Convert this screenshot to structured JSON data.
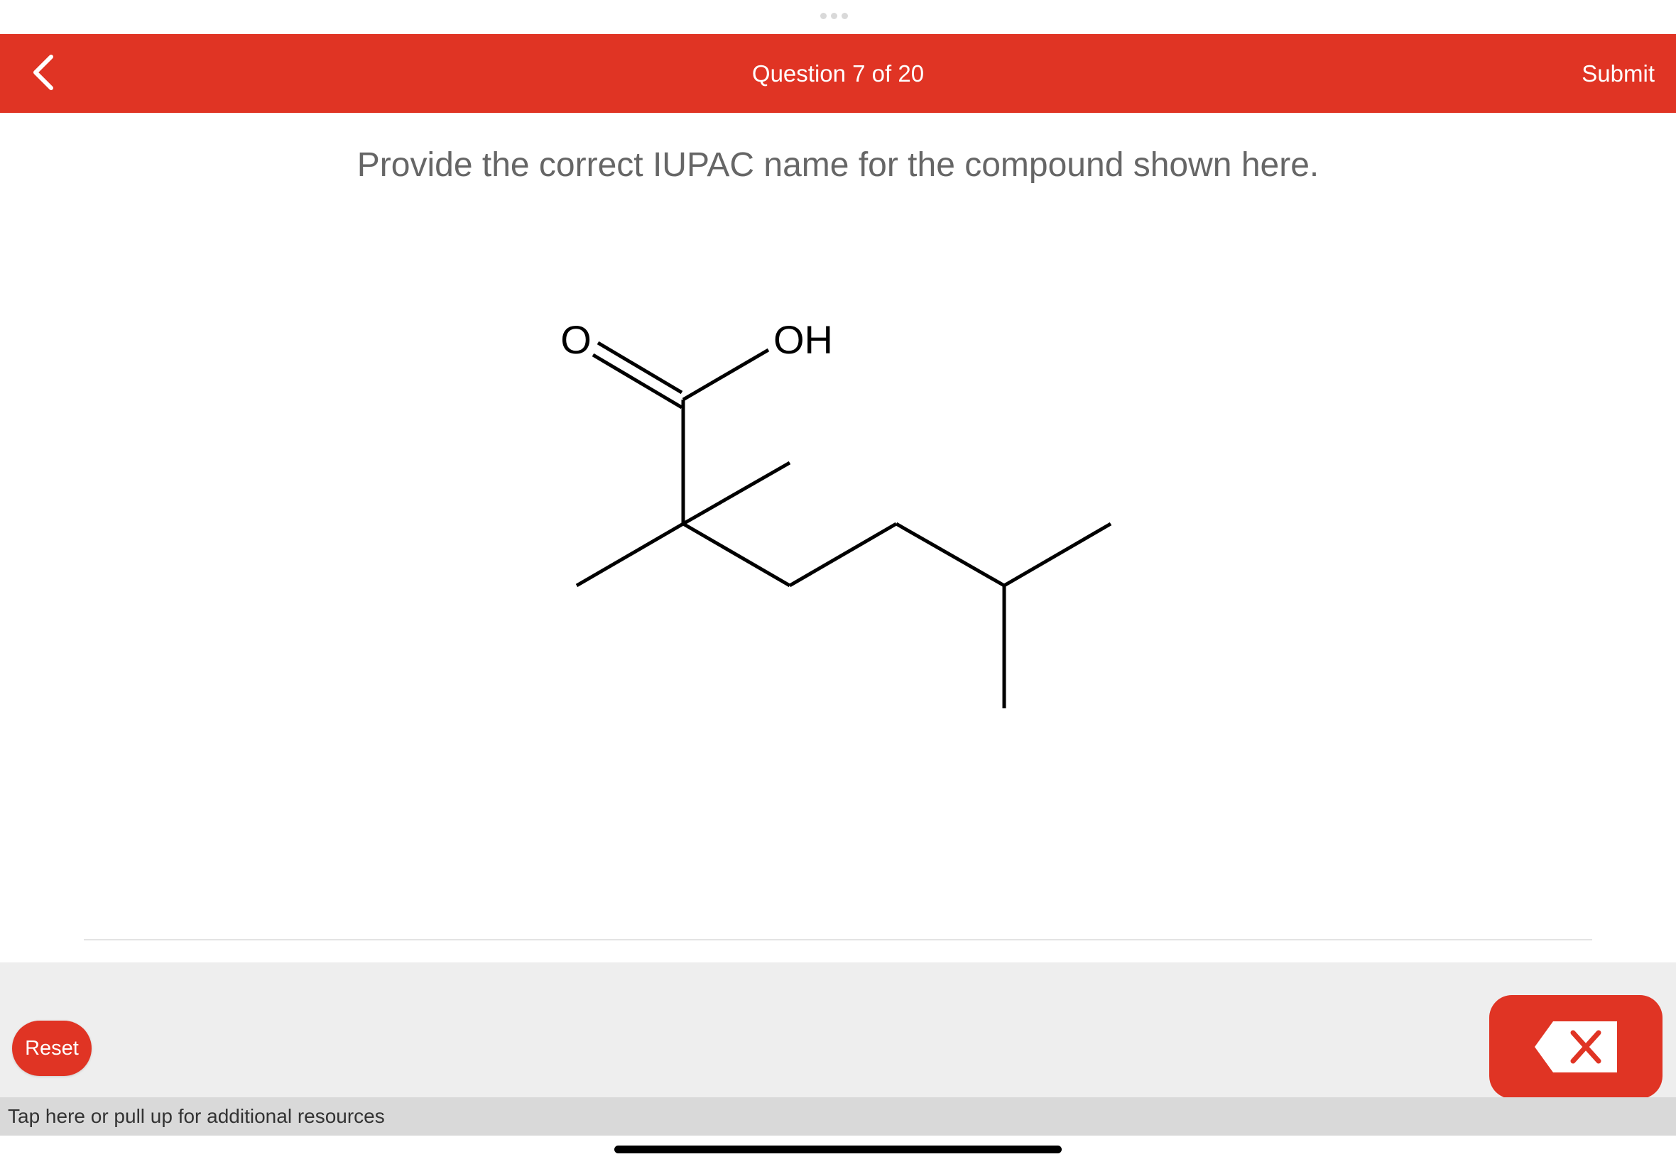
{
  "header": {
    "question_counter": "Question 7 of 20",
    "submit_label": "Submit"
  },
  "question": {
    "prompt": "Provide the correct IUPAC name for the compound shown here."
  },
  "molecule": {
    "labels": {
      "carbonyl_oxygen": "O",
      "hydroxyl": "OH"
    }
  },
  "controls": {
    "reset_label": "Reset",
    "resources_label": "Tap here or pull up for additional resources"
  },
  "colors": {
    "accent": "#e03424",
    "panel_bg": "#eeeeee",
    "resources_bg": "#d9d9d9"
  },
  "icons": {
    "back": "chevron-left-icon",
    "delete": "backspace-icon"
  }
}
